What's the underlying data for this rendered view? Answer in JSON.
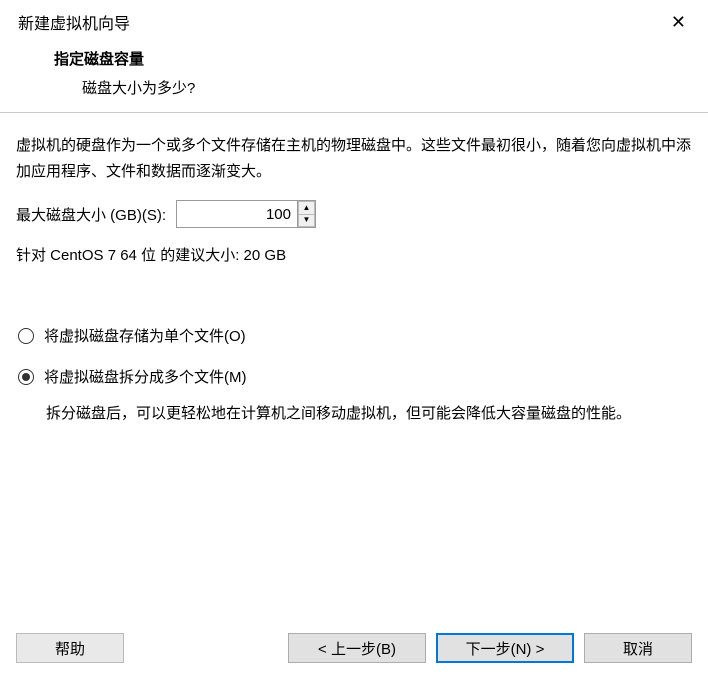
{
  "window": {
    "title": "新建虚拟机向导",
    "close": "✕"
  },
  "header": {
    "bold_title": "指定磁盘容量",
    "subtitle": "磁盘大小为多少?"
  },
  "body": {
    "description": "虚拟机的硬盘作为一个或多个文件存储在主机的物理磁盘中。这些文件最初很小，随着您向虚拟机中添加应用程序、文件和数据而逐渐变大。",
    "size_label": "最大磁盘大小 (GB)(S):",
    "size_value": "100",
    "recommend": "针对 CentOS 7 64 位 的建议大小: 20 GB",
    "radio": {
      "single_file": "将虚拟磁盘存储为单个文件(O)",
      "multi_file": "将虚拟磁盘拆分成多个文件(M)",
      "multi_note": "拆分磁盘后，可以更轻松地在计算机之间移动虚拟机，但可能会降低大容量磁盘的性能。"
    }
  },
  "buttons": {
    "help": "帮助",
    "back": "< 上一步(B)",
    "next": "下一步(N) >",
    "cancel": "取消"
  }
}
